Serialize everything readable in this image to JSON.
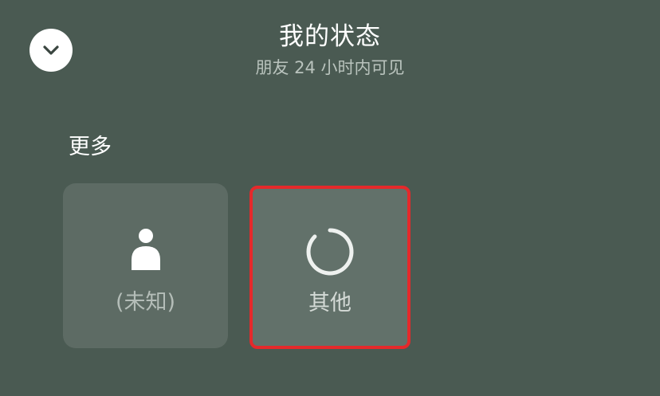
{
  "header": {
    "title": "我的状态",
    "subtitle": "朋友 24 小时内可见"
  },
  "collapse_button": {
    "icon": "chevron-down-icon"
  },
  "section": {
    "label": "更多"
  },
  "status_options": [
    {
      "label": "(未知)",
      "icon": "person-icon",
      "selected": false
    },
    {
      "label": "其他",
      "icon": "circle-loading-icon",
      "selected": true
    }
  ],
  "colors": {
    "background": "#4a5a52",
    "card": "#5d6b64",
    "highlight_border": "#e5292b"
  }
}
